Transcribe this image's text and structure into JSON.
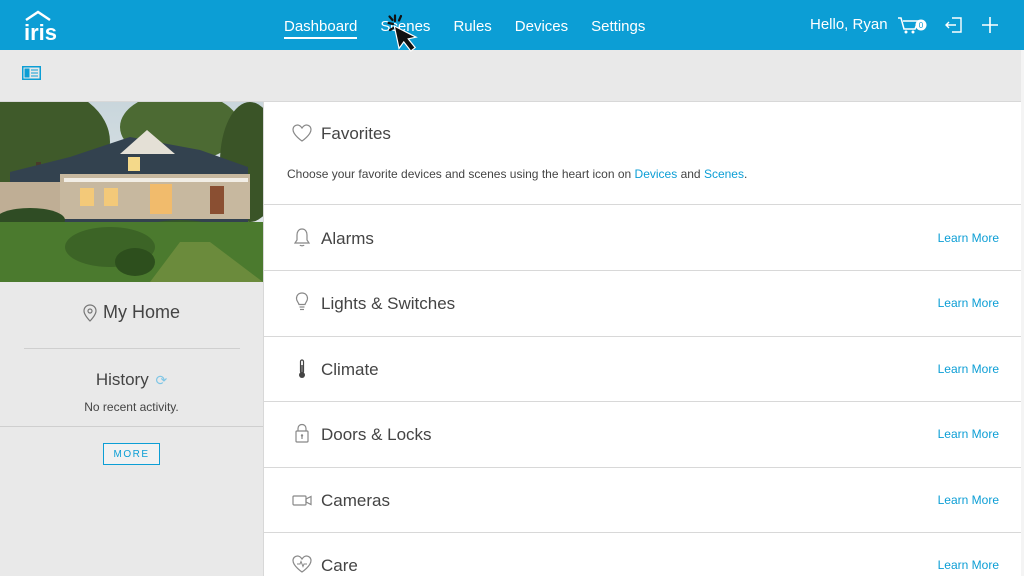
{
  "app": {
    "logo_text": "iris"
  },
  "nav": {
    "items": [
      {
        "label": "Dashboard",
        "active": true
      },
      {
        "label": "Scenes",
        "active": false
      },
      {
        "label": "Rules",
        "active": false
      },
      {
        "label": "Devices",
        "active": false
      },
      {
        "label": "Settings",
        "active": false
      }
    ],
    "greeting": "Hello, Ryan",
    "cart_count": "0"
  },
  "sidebar": {
    "home_name": "My Home",
    "history_title": "History",
    "history_empty": "No recent activity.",
    "more_label": "MORE"
  },
  "cards": {
    "favorites": {
      "title": "Favorites",
      "desc_pre": "Choose your favorite devices and scenes using the heart icon on ",
      "link_devices": "Devices",
      "desc_mid": " and ",
      "link_scenes": "Scenes",
      "desc_post": "."
    },
    "alarms": {
      "title": "Alarms",
      "learn": "Learn More"
    },
    "lights": {
      "title": "Lights & Switches",
      "learn": "Learn More"
    },
    "climate": {
      "title": "Climate",
      "learn": "Learn More"
    },
    "doors": {
      "title": "Doors & Locks",
      "learn": "Learn More"
    },
    "cameras": {
      "title": "Cameras",
      "learn": "Learn More"
    },
    "care": {
      "title": "Care",
      "learn": "Learn More"
    }
  },
  "colors": {
    "brand": "#0c9ed5",
    "background": "#e9e9e9",
    "card": "#ffffff"
  }
}
